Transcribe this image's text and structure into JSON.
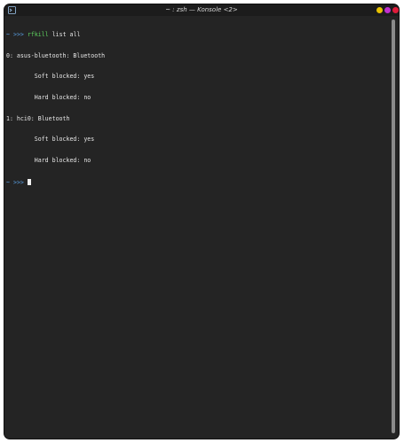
{
  "window": {
    "title": "~ : zsh — Konsole <2>",
    "buttons": {
      "minimize_color": "#e8c200",
      "maximize_color": "#c02fd0",
      "close_color": "#e01c3a"
    },
    "background": "#242424"
  },
  "terminal": {
    "lines": [
      {
        "type": "command",
        "tilde": "~",
        "arrows": ">>>",
        "cmd": "rfkill",
        "args": "list all"
      },
      {
        "type": "output",
        "text": "0: asus-bluetooth: Bluetooth"
      },
      {
        "type": "output",
        "text": "        Soft blocked: yes"
      },
      {
        "type": "output",
        "text": "        Hard blocked: no"
      },
      {
        "type": "output",
        "text": "1: hci0: Bluetooth"
      },
      {
        "type": "output",
        "text": "        Soft blocked: yes"
      },
      {
        "type": "output",
        "text": "        Hard blocked: no"
      },
      {
        "type": "prompt",
        "tilde": "~",
        "arrows": ">>>"
      }
    ]
  }
}
